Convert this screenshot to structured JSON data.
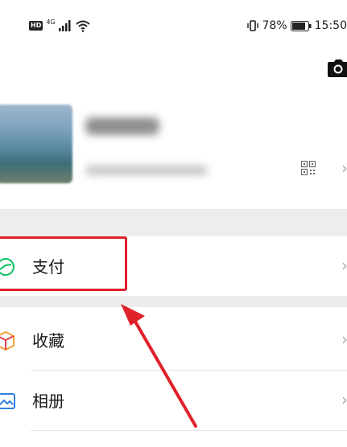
{
  "status_bar": {
    "hd": "HD",
    "network": "4G",
    "battery": "78%",
    "time": "15:50"
  },
  "profile": {
    "name_blurred": true
  },
  "menu": {
    "items": [
      {
        "label": "支付",
        "icon": "payment-icon"
      },
      {
        "label": "收藏",
        "icon": "favorites-icon"
      },
      {
        "label": "相册",
        "icon": "album-icon"
      }
    ]
  },
  "annotation": {
    "highlight_color": "#e0212a",
    "arrow_color": "#e0212a"
  },
  "colors": {
    "payment_green": "#07c160",
    "favorites_orange": "#f2a33a",
    "favorites_red": "#e64545",
    "album_blue": "#2f7fe0",
    "separator": "#ededed"
  }
}
